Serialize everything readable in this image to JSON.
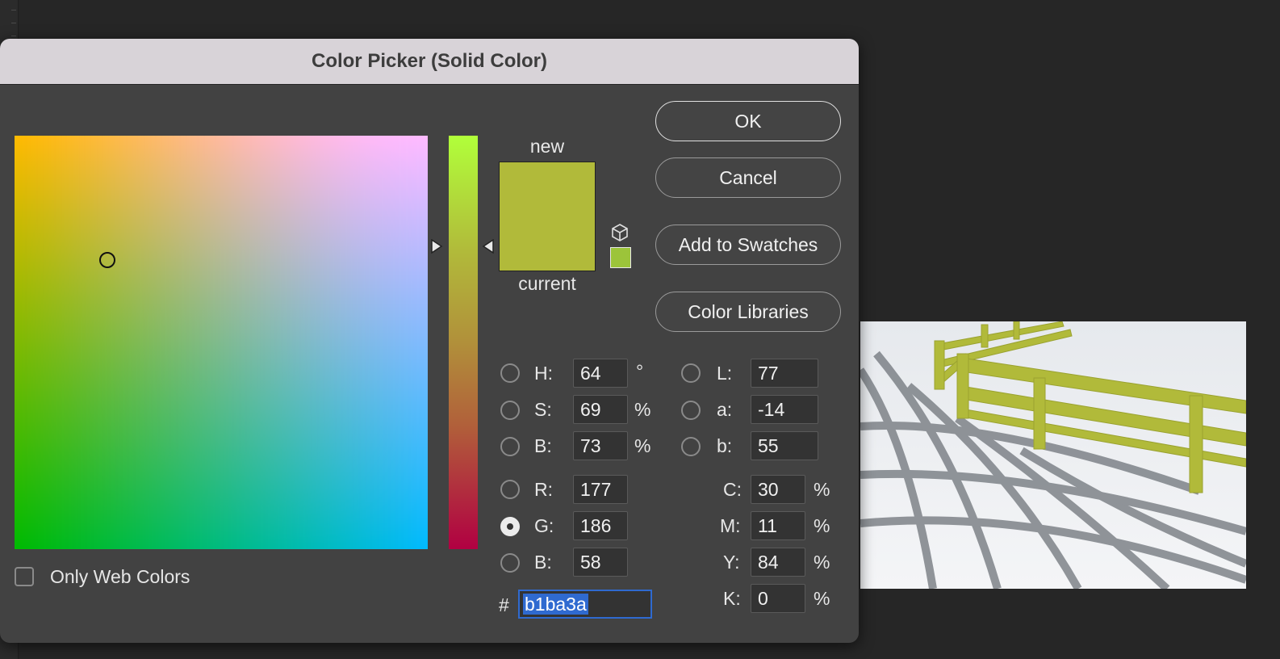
{
  "dialog": {
    "title": "Color Picker (Solid Color)",
    "buttons": {
      "ok": "OK",
      "cancel": "Cancel",
      "add_to_swatches": "Add to Swatches",
      "color_libraries": "Color Libraries"
    },
    "preview": {
      "new_label": "new",
      "current_label": "current",
      "new_color": "#b1ba3a",
      "current_color": "#b1ba3a",
      "gamut_swatch_color": "#9cc43a"
    },
    "hsb": [
      {
        "label": "H:",
        "value": "64",
        "unit": "°",
        "selected": false
      },
      {
        "label": "S:",
        "value": "69",
        "unit": "%",
        "selected": false
      },
      {
        "label": "B:",
        "value": "73",
        "unit": "%",
        "selected": false
      }
    ],
    "rgb": [
      {
        "label": "R:",
        "value": "177",
        "selected": false
      },
      {
        "label": "G:",
        "value": "186",
        "selected": true
      },
      {
        "label": "B:",
        "value": "58",
        "selected": false
      }
    ],
    "lab": [
      {
        "label": "L:",
        "value": "77"
      },
      {
        "label": "a:",
        "value": "-14"
      },
      {
        "label": "b:",
        "value": "55"
      }
    ],
    "cmyk": [
      {
        "label": "C:",
        "value": "30",
        "unit": "%"
      },
      {
        "label": "M:",
        "value": "11",
        "unit": "%"
      },
      {
        "label": "Y:",
        "value": "84",
        "unit": "%"
      },
      {
        "label": "K:",
        "value": "0",
        "unit": "%"
      }
    ],
    "hex": {
      "prefix": "#",
      "value": "b1ba3a"
    },
    "only_web_colors": {
      "label": "Only Web Colors",
      "checked": false
    },
    "colors": {
      "accent": "#2f6ad0",
      "panel": "#424242",
      "titlebar": "#d8d3d8",
      "fence": "#b1ba3a"
    }
  }
}
